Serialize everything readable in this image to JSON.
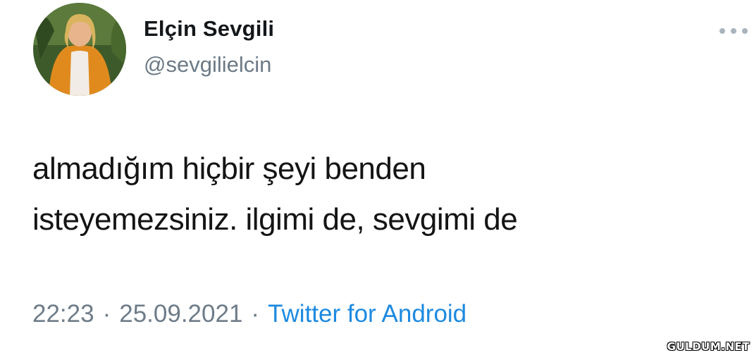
{
  "author": {
    "display_name": "Elçin Sevgili",
    "handle": "@sevgilielcin",
    "avatar_icon": "profile-photo"
  },
  "tweet": {
    "text_lines": [
      "almadığım hiçbir şeyi benden",
      "isteyemezsiniz. ilgimi de, sevgimi de"
    ]
  },
  "meta": {
    "time": "22:23",
    "separator": "·",
    "date": "25.09.2021",
    "source": "Twitter for Android"
  },
  "icons": {
    "more": "more-options-icon"
  },
  "colors": {
    "handle_gray": "#6c7a86",
    "link_blue": "#1d8ae0",
    "text": "#141414"
  },
  "watermark": "GULDUM.NET"
}
